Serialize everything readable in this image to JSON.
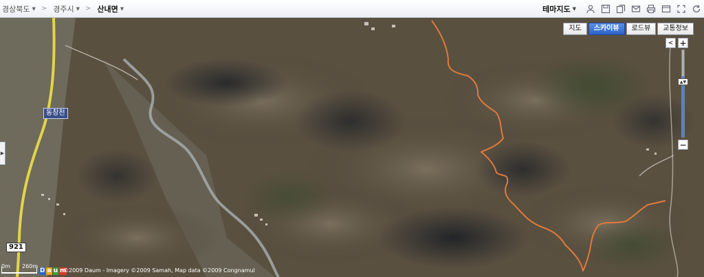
{
  "breadcrumb": {
    "items": [
      {
        "label": "경상북도"
      },
      {
        "label": "경주시"
      },
      {
        "label": "산내면"
      }
    ],
    "separator": ">"
  },
  "toolbar": {
    "theme_map_label": "테마지도",
    "icons": [
      "user-icon",
      "save-icon",
      "copy-icon",
      "mail-icon",
      "print-icon",
      "link-icon",
      "fullscreen-icon",
      "refresh-icon"
    ]
  },
  "map": {
    "view_type_buttons": [
      {
        "label": "지도",
        "active": false
      },
      {
        "label": "스카이뷰",
        "active": true
      },
      {
        "label": "로드뷰",
        "active": false
      },
      {
        "label": "교통정보",
        "active": false
      }
    ],
    "place_label": "동창천",
    "road_number": "921",
    "zoom_controls": {
      "in": "+",
      "out": "−",
      "left": "<"
    },
    "zoom_level_fraction": 0.7,
    "scale": {
      "start": "0m",
      "end": "260m"
    },
    "logo_letters": [
      "D",
      "a",
      "u",
      "m"
    ],
    "copyright": "©2009 Daum - Imagery ©2009 Samah, Map data ©2009 Congnamul",
    "colors": {
      "route": "#e07a3c",
      "road_primary": "#e3d44a",
      "active_button": "#2d63c8",
      "place_label_bg": "#3a4f8a"
    }
  }
}
